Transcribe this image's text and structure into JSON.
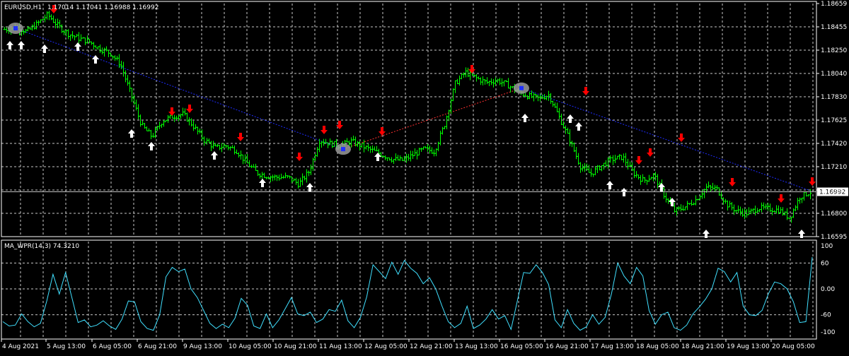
{
  "header": {
    "symbol": "EURUSD,H1",
    "ohlc": "1.17014 1.17041 1.16988 1.16992"
  },
  "current_price_label": "1.16992",
  "indicator_header": "MA_WPR(14,3) 74.3210",
  "colors": {
    "background": "#000000",
    "grid": "#c8c8c8",
    "price_bar": "#00ff00",
    "indicator_line": "#40e0ff",
    "arrow_up": "#ffffff",
    "arrow_down": "#ff0000",
    "trend_blue": "#1e2cff",
    "trend_red": "#ff3030",
    "current_price_line": "#c0c0c0"
  },
  "chart_data": [
    {
      "type": "bar",
      "title": "EURUSD,H1",
      "ylim": [
        1.16595,
        1.18659
      ],
      "y_ticks": [
        "1.18659",
        "1.18455",
        "1.18250",
        "1.18040",
        "1.17830",
        "1.17625",
        "1.17420",
        "1.17210",
        "1.17005",
        "1.16800",
        "1.16595"
      ],
      "x_ticks": [
        "4 Aug 2021",
        "5 Aug 13:00",
        "6 Aug 05:00",
        "6 Aug 21:00",
        "9 Aug 13:00",
        "10 Aug 05:00",
        "10 Aug 21:00",
        "11 Aug 13:00",
        "12 Aug 05:00",
        "12 Aug 21:00",
        "13 Aug 13:00",
        "16 Aug 05:00",
        "16 Aug 21:00",
        "17 Aug 13:00",
        "18 Aug 05:00",
        "18 Aug 21:00",
        "19 Aug 13:00",
        "20 Aug 05:00"
      ],
      "series": [
        {
          "values": [
            1.1843,
            1.1845,
            1.1841,
            1.1848,
            1.1856,
            1.1846,
            1.1839,
            1.1835,
            1.1832,
            1.1826,
            1.1822,
            1.1812,
            1.1785,
            1.1758,
            1.1748,
            1.1762,
            1.1766,
            1.1768,
            1.1757,
            1.1745,
            1.1738,
            1.174,
            1.1736,
            1.1725,
            1.1716,
            1.1713,
            1.1712,
            1.1712,
            1.1706,
            1.1717,
            1.1745,
            1.1742,
            1.174,
            1.1744,
            1.174,
            1.1736,
            1.1732,
            1.1728,
            1.1727,
            1.1732,
            1.1737,
            1.1735,
            1.1759,
            1.1795,
            1.1805,
            1.18,
            1.1796,
            1.1798,
            1.1794,
            1.1788,
            1.1784,
            1.1782,
            1.1785,
            1.1765,
            1.1745,
            1.1722,
            1.1715,
            1.1722,
            1.1728,
            1.173,
            1.1716,
            1.1709,
            1.1714,
            1.1696,
            1.1682,
            1.1686,
            1.1692,
            1.1703,
            1.1702,
            1.1688,
            1.1682,
            1.168,
            1.1685,
            1.1684,
            1.1683,
            1.1676,
            1.1695,
            1.1699
          ]
        }
      ],
      "current_price": 1.16992
    },
    {
      "type": "line",
      "title": "MA_WPR(14,3) 74.3210",
      "ylim": [
        -100,
        100
      ],
      "y_ticks": [
        "100",
        "60",
        "0.00",
        "-60",
        "-100"
      ],
      "series": [
        {
          "name": "MA_WPR(14,3)",
          "values": [
            -76,
            -86,
            -84,
            -58,
            -76,
            -88,
            -80,
            -28,
            34,
            -12,
            38,
            -20,
            -78,
            -72,
            -88,
            -84,
            -74,
            -86,
            -94,
            -70,
            -28,
            -30,
            -76,
            -92,
            -96,
            -60,
            28,
            50,
            40,
            46,
            0,
            -20,
            -50,
            -80,
            -92,
            -82,
            -90,
            -68,
            -22,
            -38,
            -86,
            -92,
            -58,
            -90,
            -72,
            -46,
            -20,
            -58,
            -62,
            -54,
            -78,
            -70,
            -48,
            -52,
            -26,
            -74,
            -90,
            -66,
            -18,
            56,
            40,
            24,
            62,
            34,
            66,
            48,
            36,
            12,
            26,
            0,
            -40,
            -76,
            -90,
            -80,
            -40,
            -92,
            -84,
            -70,
            -48,
            -70,
            -62,
            -94,
            -28,
            38,
            36,
            56,
            38,
            10,
            -72,
            -90,
            -48,
            -80,
            -96,
            -88,
            -60,
            -82,
            -66,
            -12,
            60,
            30,
            12,
            50,
            30,
            -50,
            -82,
            -60,
            -54,
            -90,
            -96,
            -84,
            -58,
            -42,
            -24,
            0,
            48,
            40,
            16,
            38,
            -40,
            -60,
            -62,
            -50,
            -12,
            16,
            12,
            0,
            -30,
            -78,
            -76,
            74
          ]
        }
      ]
    }
  ]
}
